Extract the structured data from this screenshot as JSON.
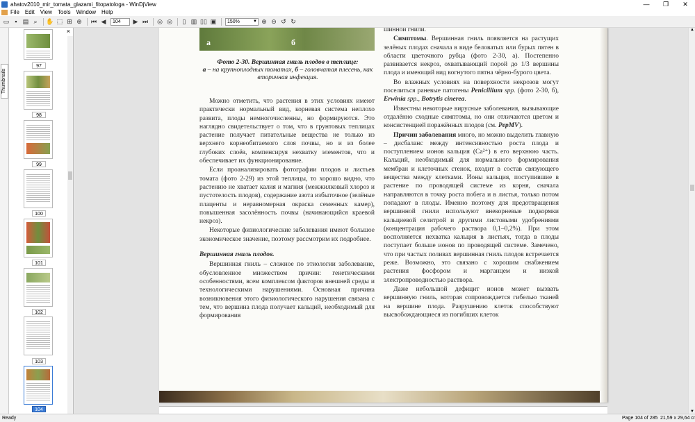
{
  "window": {
    "title": "ahatov2010_mir_tomata_glazami_fitopatologa - WinDjView",
    "minimize": "—",
    "maximize": "❐",
    "close": "✕"
  },
  "menu": {
    "items": [
      "File",
      "Edit",
      "View",
      "Tools",
      "Window",
      "Help"
    ]
  },
  "toolbar": {
    "page_number": "104",
    "zoom": "150%"
  },
  "sidebar": {
    "tab_label": "Thumbnails",
    "close": "×"
  },
  "thumbnails": [
    {
      "label": "97",
      "active": false
    },
    {
      "label": "98",
      "active": false
    },
    {
      "label": "99",
      "active": false
    },
    {
      "label": "100",
      "active": false
    },
    {
      "label": "101",
      "active": false
    },
    {
      "label": "102",
      "active": false
    },
    {
      "label": "103",
      "active": false
    },
    {
      "label": "104",
      "active": true
    }
  ],
  "page": {
    "photo_labels": {
      "a": "а",
      "b": "б"
    },
    "caption": {
      "title": "Фото 2-30. Вершинная гниль плодов в теплице:",
      "a_mark": "а",
      "a_text": " – на крупноплодных томатах, ",
      "b_mark": "б",
      "b_text": " – головчатая плесень, как вторичная инфекция."
    },
    "left_column": {
      "p1": "Можно отметить, что растения в этих условиях имеют практически нормальный вид, корневая система неплохо развита, плоды немногочисленны, но формируются. Это наглядно свидетельствует о том, что в грунтовых теплицах растение получает питательные вещества не только из верхнего корнеобитаемого слоя почвы, но и из более глубоких слоёв, компенсируя нехватку элементов, что и обеспечивает их функционирование.",
      "p2": "Если проанализировать фотографии плодов и листьев томата (фото 2-29) из этой теплицы, то хорошо видно, что растению не хватает калия и магния (межжилковый хлороз и пустотелость плодов), содержание азота избыточное (зелёные плаценты и неравномерная окраска семенных камер), повышенная засолённость почвы (начинающийся краевой некроз).",
      "p3": "Некоторые физиологические заболевания имеют большое экономическое значение, поэтому рассмотрим их подробнее.",
      "heading": "Вершинная гниль плодов.",
      "p4": "Вершинная гниль – сложное по этиологии заболевание, обусловленное множеством причин: генетическими особенностями, всем комплексом факторов внешней среды и технологическими нарушениями. Основная причина возникновения этого физиологического нарушения связана с тем, что вершина плода получает кальций, необходимый для формирования"
    },
    "right_column": {
      "top": "шинной гнили.",
      "symptoms_label": "Симптомы",
      "symptoms_text": ". Вершинная гниль появляется на растущих зелёных плодах сначала в виде беловатых или бурых пятен в области цветочного рубца (фото 2-30, а). Постепенно развивается некроз, охватывающий порой до 1/3 вершины плода и имеющий вид вогнутого пятна чёрно-бурого цвета.",
      "p_moist_a": "Во влажных условиях на поверхности некрозов могут поселиться раневые патогены ",
      "penicillium": "Penicillium",
      "spp1": " spp.",
      "p_moist_b": " (фото 2-30, б), ",
      "erwinia": "Erwinia",
      "spp2": " spp., ",
      "botrytis": "Botrytis cinerea",
      "p_moist_c": ".",
      "p_virus": "Известны некоторые вирусные заболевания, вызывающие отдалённо сходные симптомы, но они отличаются цветом и консистенцией поражённых плодов (см. ",
      "pepmv": "PepMV",
      "p_virus_end": ").",
      "causes_label": "Причин заболевания",
      "causes_text": " много, но можно выделить главную – дисбаланс между интенсивностью роста плода и поступлением ионов кальция (Ca²⁺) в его верхнюю часть. Кальций, необходимый для нормального формирования мембран и клеточных стенок, входит в состав связующего вещества между клетками. Ионы кальция, поступившие в растение по проводящей системе из корня, сначала направляются в точку роста побега и в листья, только потом попадают в плоды. Именно поэтому для предотвращения вершинной гнили используют внекорневые подкормки кальциевой селитрой и другими листовыми удобрениями (концентрация рабочего раствора 0,1–0,2%). При этом восполняется нехватка кальция в листьях, тогда в плоды поступает больше ионов по проводящей системе. Замечено, что при частых поливах вершинная гниль плодов встречается реже. Возможно, это связано с хорошим снабжением растения фосфором и марганцем и низкой электропроводностью раствора.",
      "p_last": "Даже небольшой дефицит ионов может вызвать вершинную гниль, которая сопровождается гибелью тканей на вершине плода. Разрушению клеток способствуют высвобождающиеся из погибших клеток"
    }
  },
  "status": {
    "ready": "Ready",
    "page_info": "Page 104 of 285",
    "size": "21,59 x 29,64 cm"
  },
  "colors": {
    "active_thumb": "#3a7cd6",
    "photo_green": "#6f8747"
  }
}
